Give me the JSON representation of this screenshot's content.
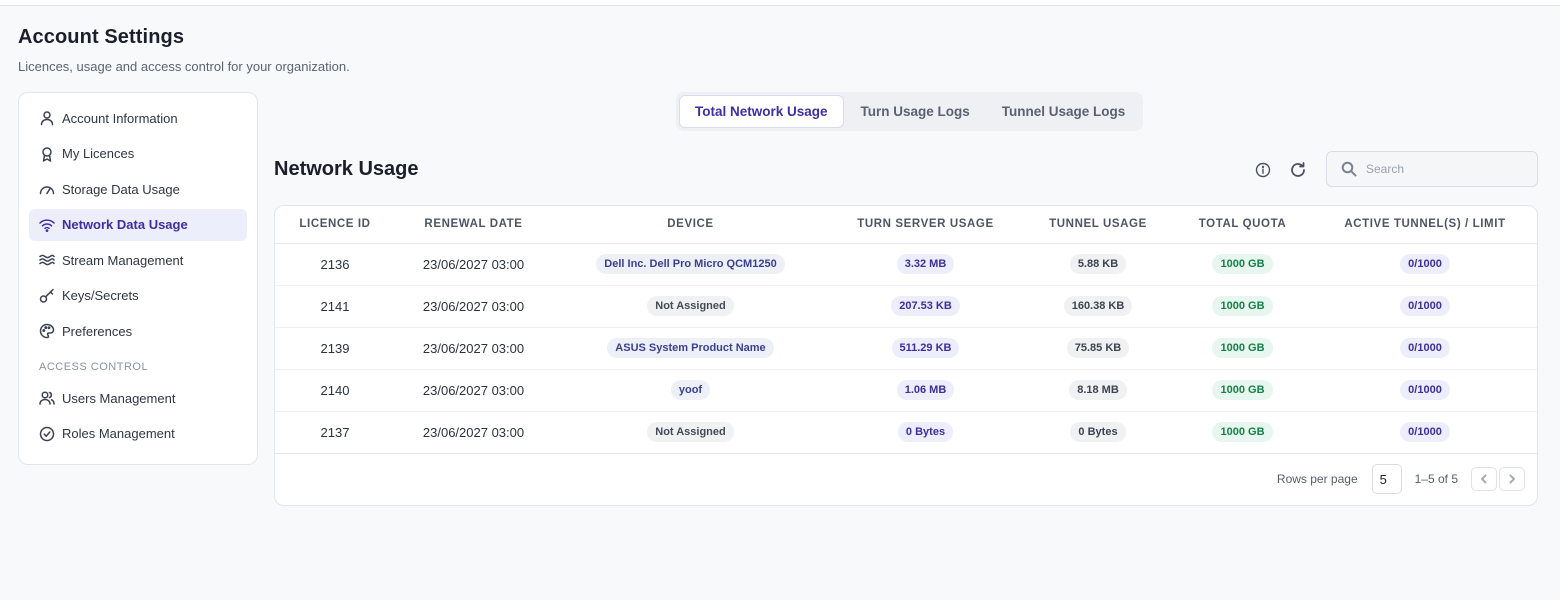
{
  "header": {
    "title": "Account Settings",
    "subtitle": "Licences, usage and access control for your organization."
  },
  "sidebar": {
    "items": [
      {
        "label": "Account Information",
        "icon": "user-icon"
      },
      {
        "label": "My Licences",
        "icon": "badge-icon"
      },
      {
        "label": "Storage Data Usage",
        "icon": "gauge-icon"
      },
      {
        "label": "Network Data Usage",
        "icon": "wifi-icon",
        "active": true
      },
      {
        "label": "Stream Management",
        "icon": "waves-icon"
      },
      {
        "label": "Keys/Secrets",
        "icon": "key-icon"
      },
      {
        "label": "Preferences",
        "icon": "palette-icon"
      }
    ],
    "section_label": "ACCESS CONTROL",
    "access_items": [
      {
        "label": "Users Management",
        "icon": "users-icon"
      },
      {
        "label": "Roles Management",
        "icon": "check-circle-icon"
      }
    ]
  },
  "tabs": [
    {
      "label": "Total Network Usage",
      "active": true
    },
    {
      "label": "Turn Usage Logs"
    },
    {
      "label": "Tunnel Usage Logs"
    }
  ],
  "section": {
    "title": "Network Usage",
    "search_placeholder": "Search"
  },
  "table": {
    "columns": [
      "LICENCE ID",
      "RENEWAL DATE",
      "DEVICE",
      "TURN SERVER USAGE",
      "TUNNEL USAGE",
      "TOTAL QUOTA",
      "ACTIVE TUNNEL(S) / LIMIT"
    ],
    "rows": [
      {
        "id": "2136",
        "renewal": "23/06/2027 03:00",
        "device": "Dell Inc. Dell Pro Micro QCM1250",
        "turn": "3.32 MB",
        "tunnel": "5.88 KB",
        "quota": "1000 GB",
        "limit": "0/1000"
      },
      {
        "id": "2141",
        "renewal": "23/06/2027 03:00",
        "device": "Not Assigned",
        "turn": "207.53 KB",
        "tunnel": "160.38 KB",
        "quota": "1000 GB",
        "limit": "0/1000"
      },
      {
        "id": "2139",
        "renewal": "23/06/2027 03:00",
        "device": "ASUS System Product Name",
        "turn": "511.29 KB",
        "tunnel": "75.85 KB",
        "quota": "1000 GB",
        "limit": "0/1000"
      },
      {
        "id": "2140",
        "renewal": "23/06/2027 03:00",
        "device": "yoof",
        "turn": "1.06 MB",
        "tunnel": "8.18 MB",
        "quota": "1000 GB",
        "limit": "0/1000"
      },
      {
        "id": "2137",
        "renewal": "23/06/2027 03:00",
        "device": "Not Assigned",
        "turn": "0 Bytes",
        "tunnel": "0 Bytes",
        "quota": "1000 GB",
        "limit": "0/1000"
      }
    ]
  },
  "pagination": {
    "rows_per_page_label": "Rows per page",
    "rows_per_page": "5",
    "range": "1–5 of 5"
  },
  "colors": {
    "accent": "#3d2fa3",
    "active_bg": "#eceefb",
    "quota_green": "#16804a"
  }
}
